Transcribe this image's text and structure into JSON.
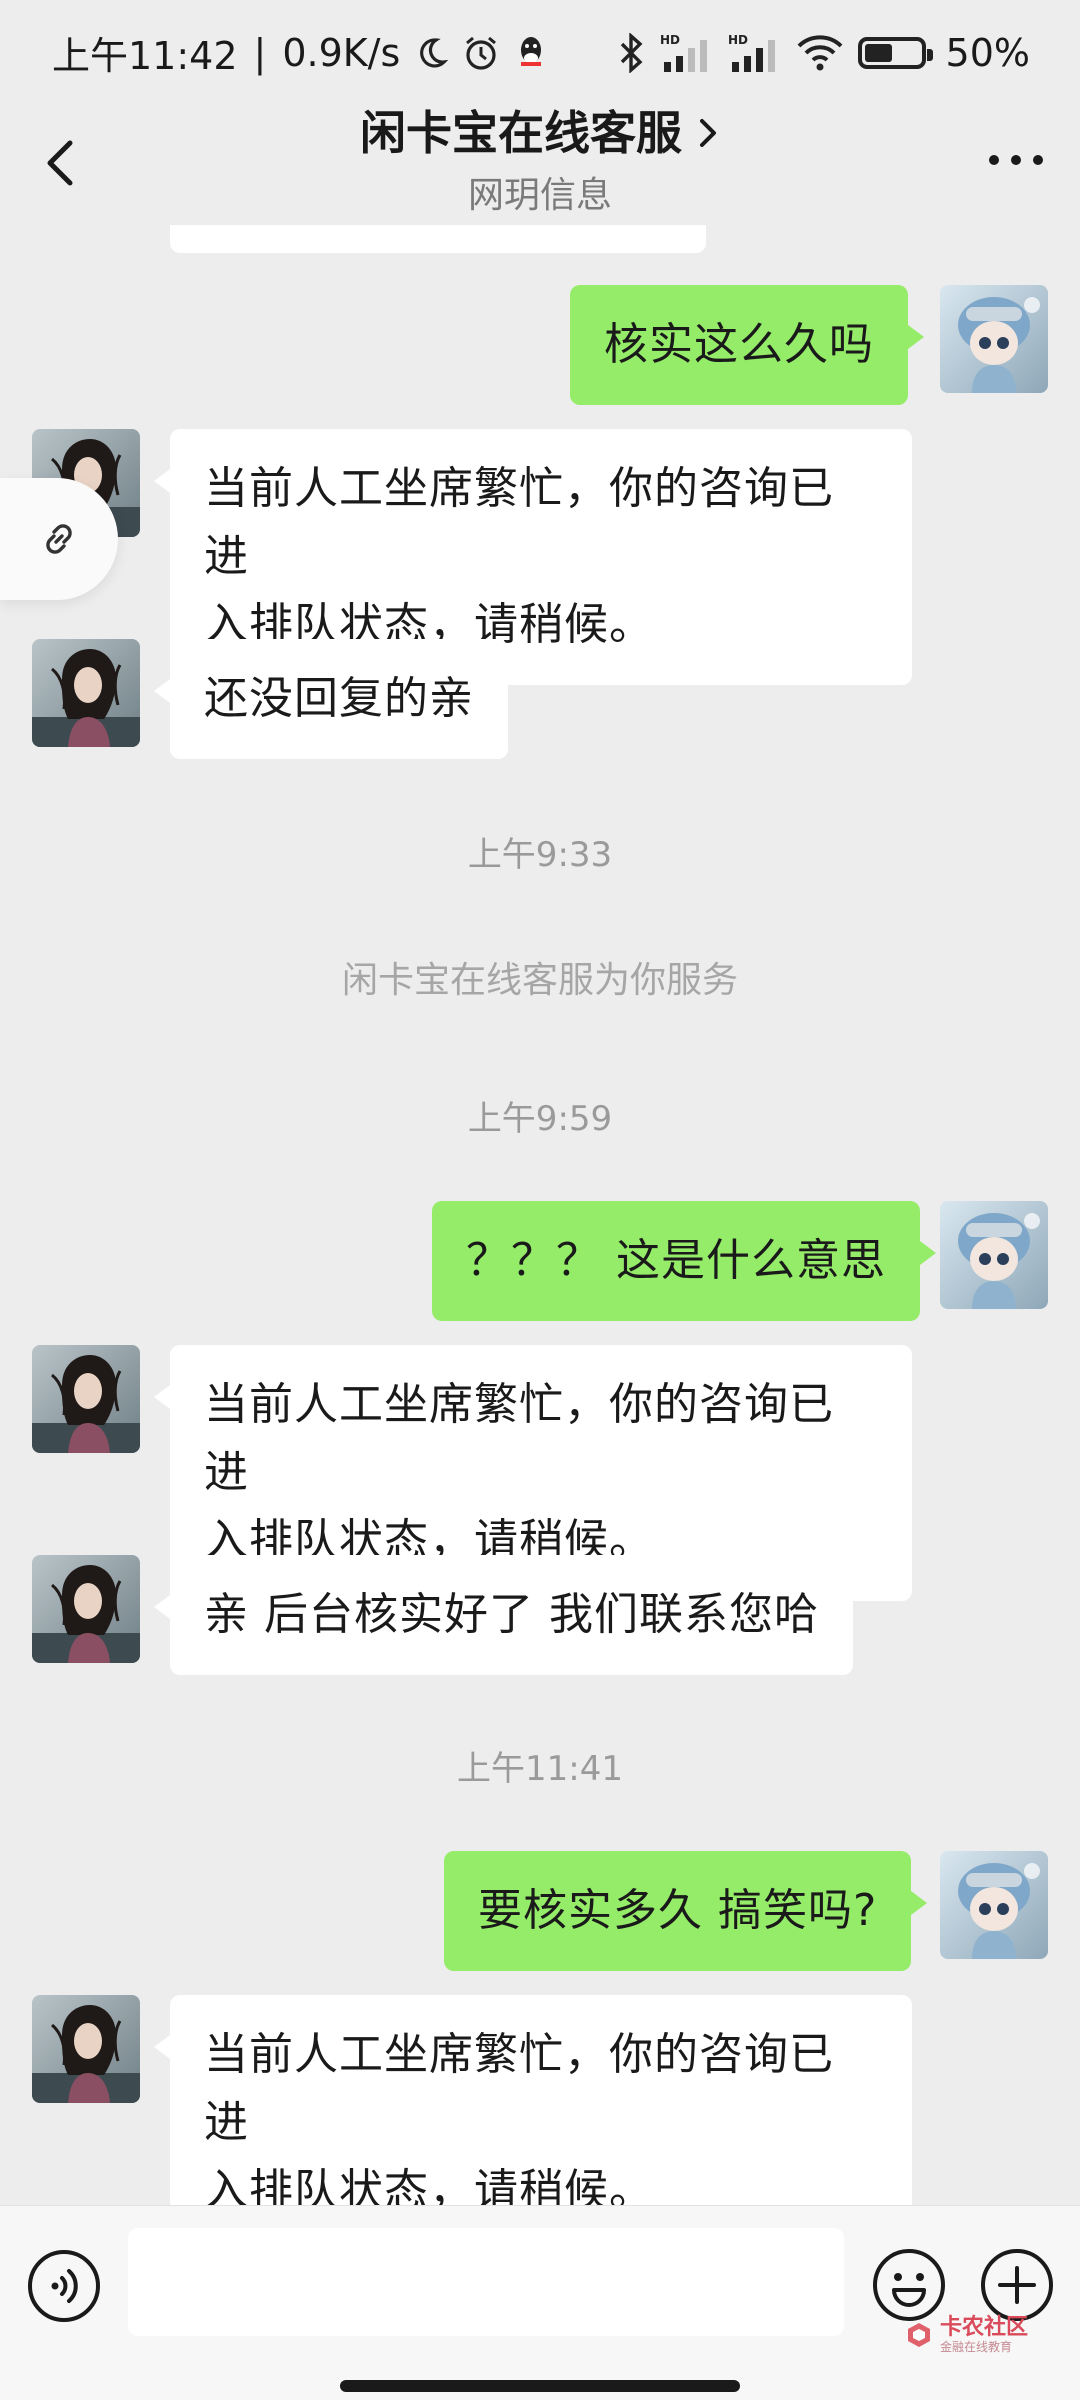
{
  "status_bar": {
    "time": "上午11:42",
    "speed": "0.9K/s",
    "battery": "50%",
    "battery_level": 0.5,
    "icons": [
      "moon-icon",
      "alarm-icon",
      "qq-icon",
      "bluetooth-icon",
      "signal-hd-icon",
      "signal-hd-icon",
      "wifi-icon",
      "battery-icon"
    ]
  },
  "header": {
    "title": "闲卡宝在线客服",
    "subtitle": "网玥信息"
  },
  "messages": [
    {
      "type": "out",
      "text": "核实这么久吗"
    },
    {
      "type": "in",
      "lines": [
        "当前人工坐席繁忙，你的咨询已进",
        "入排队状态，请稍候。"
      ]
    },
    {
      "type": "in",
      "text": "还没回复的亲"
    },
    {
      "type": "time",
      "text": "上午9:33"
    },
    {
      "type": "system",
      "text": "闲卡宝在线客服为你服务"
    },
    {
      "type": "time",
      "text": "上午9:59"
    },
    {
      "type": "out",
      "text": "？？？ 这是什么意思"
    },
    {
      "type": "in",
      "lines": [
        "当前人工坐席繁忙，你的咨询已进",
        "入排队状态，请稍候。"
      ]
    },
    {
      "type": "in",
      "text": "亲 后台核实好了 我们联系您哈"
    },
    {
      "type": "time",
      "text": "上午11:41"
    },
    {
      "type": "out",
      "text": "要核实多久 搞笑吗?"
    },
    {
      "type": "in",
      "lines": [
        "当前人工坐席繁忙，你的咨询已进",
        "入排队状态，请稍候。"
      ]
    }
  ],
  "input": {
    "placeholder": ""
  },
  "watermark": {
    "title": "卡农社区",
    "subtitle": "金融在线教育"
  },
  "colors": {
    "bg": "#ededed",
    "outgoing": "#95ec69",
    "incoming": "#ffffff"
  }
}
